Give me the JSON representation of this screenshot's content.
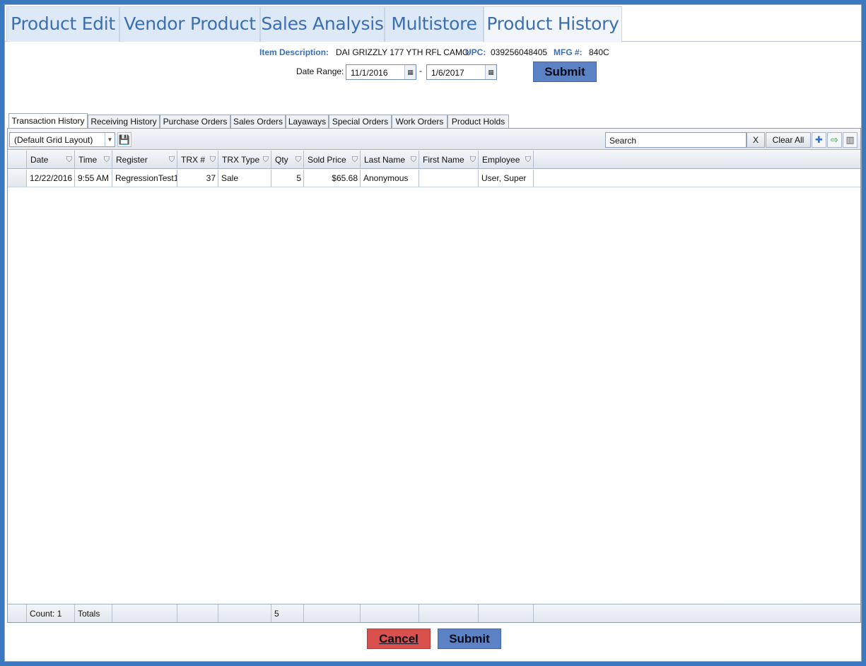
{
  "main_tabs": [
    {
      "label": "Product Edit"
    },
    {
      "label": "Vendor Product"
    },
    {
      "label": "Sales Analysis"
    },
    {
      "label": "Multistore"
    },
    {
      "label": "Product History"
    }
  ],
  "item_info": {
    "description_label": "Item Description:",
    "description_value": "DAI GRIZZLY 177 YTH RFL CAMO",
    "upc_label": "UPC:",
    "upc_value": "039256048405",
    "mfg_label": "MFG #:",
    "mfg_value": "840C"
  },
  "date_range": {
    "label": "Date Range:",
    "start": "11/1/2016",
    "separator": "-",
    "end": "1/6/2017",
    "submit_label": "Submit"
  },
  "sub_tabs": [
    {
      "label": "Transaction History"
    },
    {
      "label": "Receiving History"
    },
    {
      "label": "Purchase Orders"
    },
    {
      "label": "Sales Orders"
    },
    {
      "label": "Layaways"
    },
    {
      "label": "Special Orders"
    },
    {
      "label": "Work Orders"
    },
    {
      "label": "Product Holds"
    }
  ],
  "toolbar": {
    "layout_value": "(Default Grid Layout)",
    "search_placeholder": "Search",
    "clear_x_label": "X",
    "clear_all_label": "Clear All"
  },
  "table": {
    "columns": [
      "Date",
      "Time",
      "Register",
      "TRX #",
      "TRX Type",
      "Qty",
      "Sold Price",
      "Last Name",
      "First Name",
      "Employee"
    ],
    "rows": [
      [
        "12/22/2016",
        "9:55 AM",
        "RegressionTest1",
        "37",
        "Sale",
        "5",
        "$65.68",
        "Anonymous",
        "",
        "User, Super"
      ]
    ],
    "footer": {
      "count": "Count: 1",
      "totals": "Totals",
      "qty_total": "5"
    }
  },
  "actions": {
    "cancel_label": "Cancel",
    "submit_label": "Submit"
  },
  "colors": {
    "accent": "#3b6fb1",
    "submit": "#5b82c4",
    "cancel": "#d9504d",
    "frame": "#3a78c0"
  }
}
